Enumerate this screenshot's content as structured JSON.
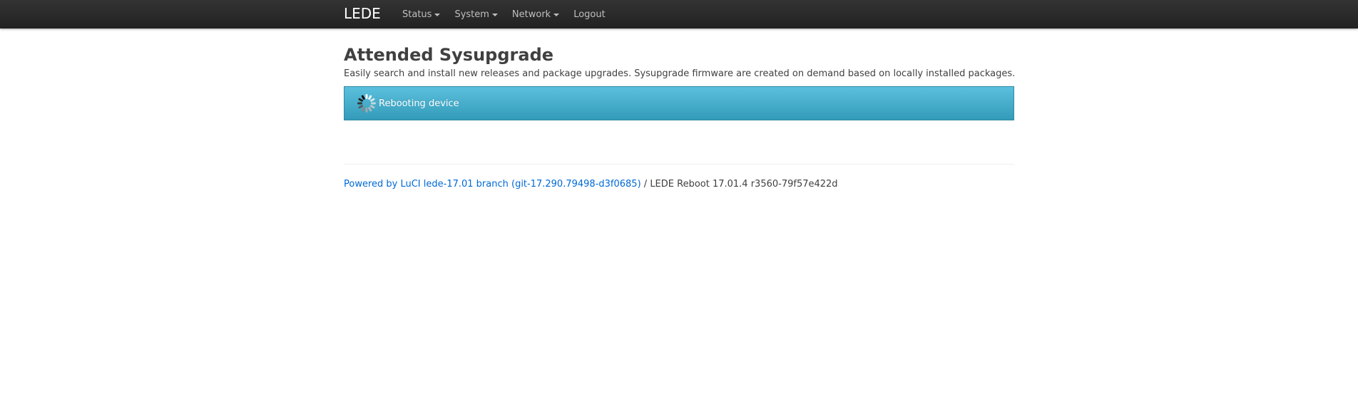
{
  "navbar": {
    "brand": "LEDE",
    "items": [
      {
        "label": "Status",
        "dropdown": true
      },
      {
        "label": "System",
        "dropdown": true
      },
      {
        "label": "Network",
        "dropdown": true
      },
      {
        "label": "Logout",
        "dropdown": false
      }
    ]
  },
  "main": {
    "title": "Attended Sysupgrade",
    "description": "Easily search and install new releases and package upgrades. Sysupgrade firmware are created on demand based on locally installed packages.",
    "alert": {
      "icon": "spinner-icon",
      "text": "Rebooting device",
      "color_top": "#5bc0de",
      "color_bottom": "#339bb9"
    }
  },
  "footer": {
    "link_text": "Powered by LuCI lede-17.01 branch (git-17.290.79498-d3f0685)",
    "separator": " / ",
    "version_text": "LEDE Reboot 17.01.4 r3560-79f57e422d",
    "link_color": "#0069d6"
  }
}
